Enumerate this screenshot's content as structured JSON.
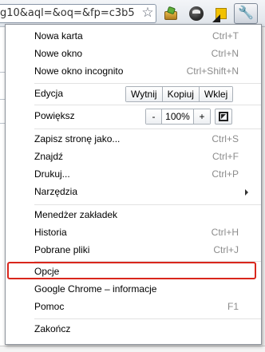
{
  "address_bar": {
    "url_text": "g10&aql=&oq=&fp=c3b5"
  },
  "menu": {
    "new_tab": {
      "label": "Nowa karta",
      "shortcut": "Ctrl+T"
    },
    "new_window": {
      "label": "Nowe okno",
      "shortcut": "Ctrl+N"
    },
    "new_incognito": {
      "label": "Nowe okno incognito",
      "shortcut": "Ctrl+Shift+N"
    },
    "edit": {
      "label": "Edycja",
      "cut": "Wytnij",
      "copy": "Kopiuj",
      "paste": "Wklej"
    },
    "zoom": {
      "label": "Powiększ",
      "minus": "-",
      "value": "100%",
      "plus": "+"
    },
    "save_as": {
      "label": "Zapisz stronę jako...",
      "shortcut": "Ctrl+S"
    },
    "find": {
      "label": "Znajdź",
      "shortcut": "Ctrl+F"
    },
    "print": {
      "label": "Drukuj...",
      "shortcut": "Ctrl+P"
    },
    "tools": {
      "label": "Narzędzia"
    },
    "bookmark_manager": {
      "label": "Menedżer zakładek"
    },
    "history": {
      "label": "Historia",
      "shortcut": "Ctrl+H"
    },
    "downloads": {
      "label": "Pobrane pliki",
      "shortcut": "Ctrl+J"
    },
    "options": {
      "label": "Opcje"
    },
    "about": {
      "label": "Google Chrome – informacje"
    },
    "help": {
      "label": "Pomoc",
      "shortcut": "F1"
    },
    "exit": {
      "label": "Zakończ"
    }
  },
  "colors": {
    "highlight": "#d9261c"
  },
  "icons": {
    "bookmark_star": "star-icon",
    "wrench": "wrench-icon",
    "submenu": "chevron-right-icon",
    "fullscreen": "fullscreen-icon"
  }
}
